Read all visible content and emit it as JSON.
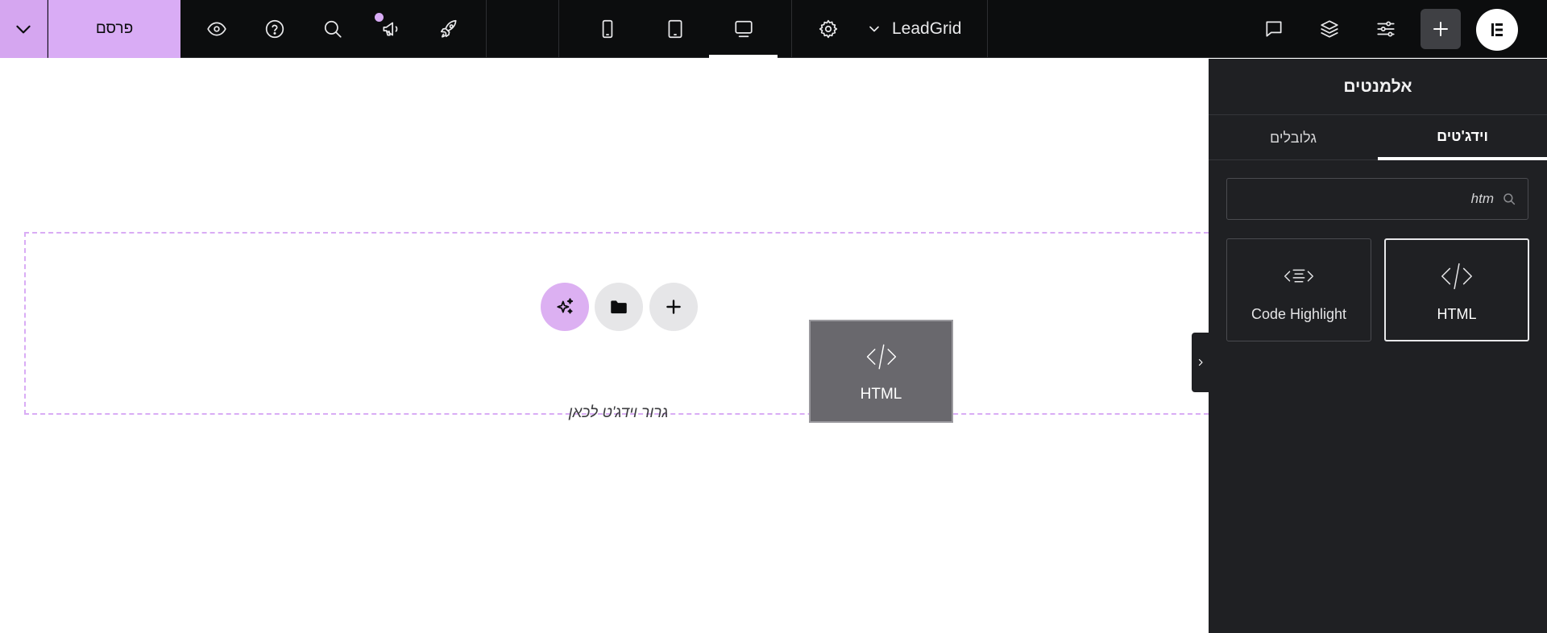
{
  "topbar": {
    "publish_label": "פרסם",
    "site_name": "LeadGrid",
    "icons": {
      "publish_options": "chevron-down-icon",
      "preview": "eye-icon",
      "help": "question-icon",
      "search": "search-icon",
      "notifications": "megaphone-icon",
      "launch": "rocket-icon",
      "mobile": "mobile-icon",
      "tablet": "tablet-icon",
      "desktop": "desktop-icon",
      "settings": "gear-icon",
      "comments": "comment-icon",
      "structure": "layers-icon",
      "site_settings": "sliders-icon",
      "add": "plus-icon",
      "logo": "elementor-logo-icon"
    },
    "active_device": "desktop"
  },
  "canvas": {
    "drop_text": "גרור וידג'ט לכאן",
    "drag_ghost_label": "HTML"
  },
  "panel": {
    "title": "אלמנטים",
    "tabs": [
      {
        "label": "וידג'טים",
        "active": true
      },
      {
        "label": "גלובלים",
        "active": false
      }
    ],
    "search_value": "htm",
    "widgets": [
      {
        "label": "HTML",
        "icon": "code-icon",
        "selected": true
      },
      {
        "label": "Code Highlight",
        "icon": "code-highlight-icon",
        "selected": false
      }
    ]
  },
  "colors": {
    "accent": "#d9acf5",
    "topbar_bg": "#0c0d0e",
    "panel_bg": "#1f2023",
    "drag_ghost_bg": "#69686d"
  }
}
